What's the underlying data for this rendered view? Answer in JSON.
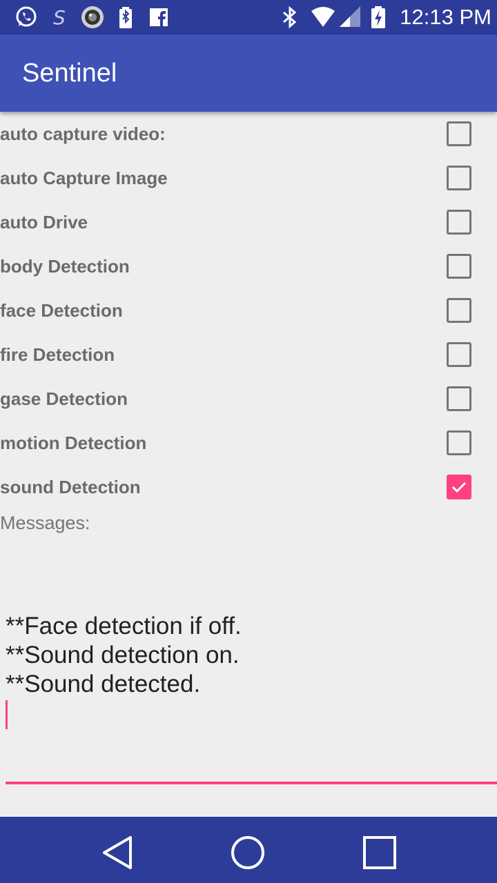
{
  "status_bar": {
    "time": "12:13 PM",
    "left_icons": [
      "whatsapp-icon",
      "s-app-icon",
      "camera-lens-icon",
      "battery-charging-icon",
      "facebook-icon"
    ],
    "right_icons": [
      "bluetooth-icon",
      "wifi-icon",
      "signal-icon",
      "battery-icon"
    ]
  },
  "app_bar": {
    "title": "Sentinel"
  },
  "settings": [
    {
      "label": "auto capture video:",
      "checked": false
    },
    {
      "label": "auto Capture Image",
      "checked": false
    },
    {
      "label": "auto Drive",
      "checked": false
    },
    {
      "label": "body Detection",
      "checked": false
    },
    {
      "label": "face Detection",
      "checked": false
    },
    {
      "label": "fire Detection",
      "checked": false
    },
    {
      "label": "gase Detection",
      "checked": false
    },
    {
      "label": "motion Detection",
      "checked": false
    },
    {
      "label": "sound Detection",
      "checked": true
    }
  ],
  "messages": {
    "label": "Messages:",
    "lines": [
      "**Face detection if off.",
      "**Sound detection on.",
      "**Sound detected."
    ]
  },
  "colors": {
    "primary": "#3f51b5",
    "primary_dark": "#2e3c99",
    "accent": "#ff4081",
    "background": "#eeeeee"
  },
  "nav_bar": {
    "buttons": [
      "back-icon",
      "home-icon",
      "recents-icon"
    ]
  }
}
